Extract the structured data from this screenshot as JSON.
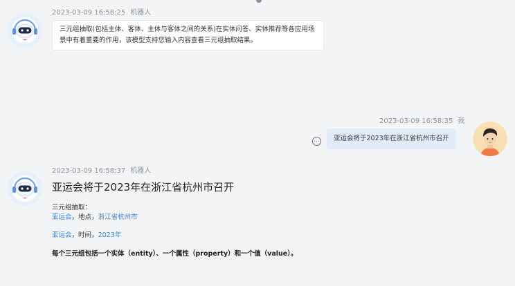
{
  "messages": [
    {
      "role": "bot",
      "timestamp": "2023-03-09 16:58:25",
      "sender": "机器人",
      "text": "三元组抽取(包括主体、客体、主体与客体之间的关系)在实体问答、实体推荐等各应用场景中有着重要的作用，该模型支持您输入内容查看三元组抽取结果。"
    },
    {
      "role": "user",
      "timestamp": "2023-03-09 16:58:35",
      "sender": "我",
      "text": "亚运会将于2023年在浙江省杭州市召开",
      "more_icon": "more-options-icon"
    },
    {
      "role": "bot",
      "timestamp": "2023-03-09 16:58:37",
      "sender": "机器人",
      "title": "亚运会将于2023年在浙江省杭州市召开",
      "result_heading": "三元组抽取：",
      "triples": [
        {
          "entity": "亚运会",
          "sep1": "，",
          "property": "地点",
          "sep2": "，",
          "value": "浙江省杭州市"
        },
        {
          "entity": "亚运会",
          "sep1": "，",
          "property": "时间",
          "sep2": "，",
          "value": "2023年"
        }
      ],
      "note": "每个三元组包括一个实体（entity）、一个属性（property）和一个值（value）。"
    }
  ],
  "colors": {
    "background": "#f3f4f6",
    "link": "#3b82d6",
    "user_bubble": "#e3ebf9",
    "bot_bubble": "#ffffff",
    "meta_text": "#8d939c"
  },
  "icons": {
    "bot_avatar": "robot-headset-avatar-icon",
    "user_avatar": "user-avatar-icon"
  }
}
